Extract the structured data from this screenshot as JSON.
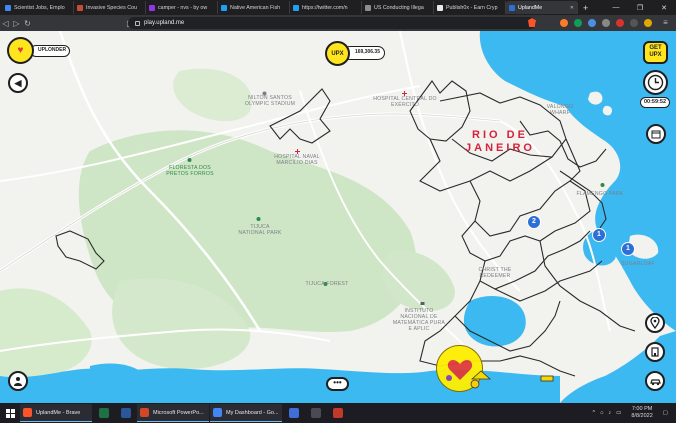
{
  "browser": {
    "tabs": [
      {
        "title": "Scientist Jobs, Emplo",
        "color": "#4285f4"
      },
      {
        "title": "Invasive Species Cou",
        "color": "#c94c34"
      },
      {
        "title": "camper - nvs - by ow",
        "color": "#9334e6"
      },
      {
        "title": "Native American Fish",
        "color": "#1da1f2"
      },
      {
        "title": "https://twitter.com/n",
        "color": "#1da1f2"
      },
      {
        "title": "US Conducting Illega",
        "color": "#8d8d8d"
      },
      {
        "title": "Publish0x - Earn Cryp",
        "color": "#e9e9e9"
      },
      {
        "title": "UplandMe",
        "color": "#2c6fd6"
      }
    ],
    "new_tab": "+",
    "url": "play.upland.me"
  },
  "hud": {
    "rank": "UPLONDER",
    "upx_label": "UPX",
    "upx_balance": "169,306.35",
    "get_upx_line1": "GET",
    "get_upx_line2": "UPX",
    "timer": "00:59:52",
    "more": "•••"
  },
  "map": {
    "city_line1": "RIO DE",
    "city_line2": "JANEIRO",
    "labels": [
      {
        "key": "nilton",
        "text": "NILTON SANTOS OLYMPIC STADIUM"
      },
      {
        "key": "hospcentral",
        "text": "HOSPITAL CENTRAL DO EXÉRCITO"
      },
      {
        "key": "floresta",
        "text": "FLORESTA DOS PRETOS FORROS"
      },
      {
        "key": "hospnaval",
        "text": "HOSPITAL NAVAL MARCÍLIO DIAS"
      },
      {
        "key": "tijuca",
        "text": "TIJUCA NATIONAL PARK"
      },
      {
        "key": "tijucaforest",
        "text": "TIJUCA FOREST"
      },
      {
        "key": "christ",
        "text": "CHRIST THE REDEEMER"
      },
      {
        "key": "instituto",
        "text": "INSTITUTO NACIONAL DE MATEMÁTICA PURA E APLIC"
      },
      {
        "key": "valongo",
        "text": "VALONGO WHARF"
      },
      {
        "key": "flamengo",
        "text": "FLAMENGO PARK"
      },
      {
        "key": "sugarloaf",
        "text": "SUGARLOAF"
      }
    ],
    "clusters": [
      "2",
      "1",
      "1"
    ]
  },
  "taskbar": {
    "items": [
      {
        "label": "UplandMe - Brave",
        "color": "#fb542b"
      },
      {
        "label": "Microsoft PowerPo...",
        "color": "#d24726"
      },
      {
        "label": "My Dashboard - Go...",
        "color": "#4285f4"
      }
    ],
    "time": "7:00 PM",
    "date": "8/8/2022"
  }
}
